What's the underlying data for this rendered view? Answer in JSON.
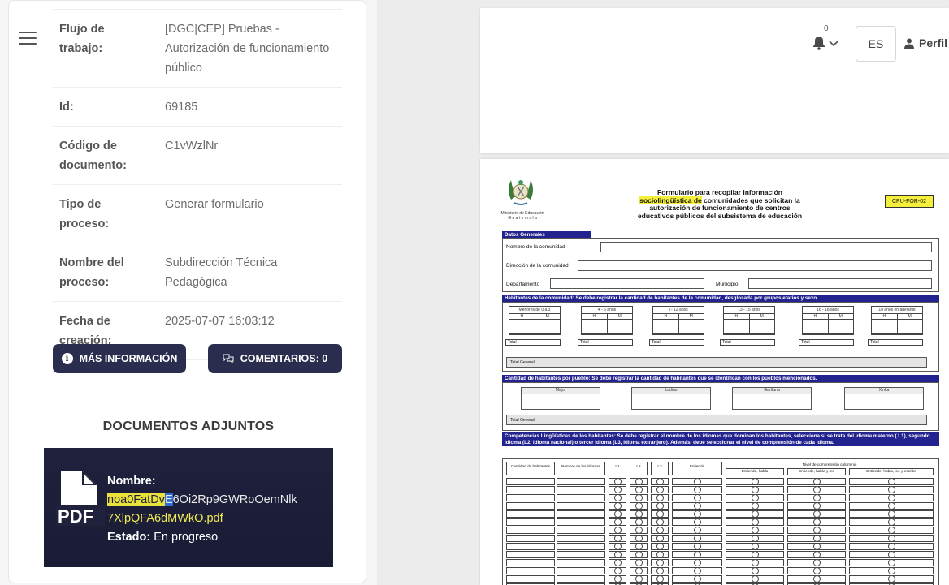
{
  "sidebar": {
    "menu_icon": "hamburger-menu-icon"
  },
  "info": [
    {
      "label": "Flujo de trabajo:",
      "value": "[DGC|CEP] Pruebas - Autorización de funcionamiento público"
    },
    {
      "label": "Id:",
      "value": "69185"
    },
    {
      "label": "Código de documento:",
      "value": "C1vWzlNr"
    },
    {
      "label": "Tipo de proceso:",
      "value": "Generar formulario"
    },
    {
      "label": "Nombre del proceso:",
      "value": "Subdirección Técnica Pedagógica"
    },
    {
      "label": "Fecha de creación:",
      "value": "2025-07-07 16:03:12"
    }
  ],
  "buttons": {
    "more_info": "MÁS INFORMACIÓN",
    "comments": "COMENTARIOS: 0"
  },
  "attachments": {
    "title": "DOCUMENTOS ADJUNTOS",
    "name_label": "Nombre:",
    "file_part1": "noa0FatDv",
    "file_part2": "E",
    "file_part3": "6Oi2Rp9GWRoOemNlk",
    "file_part4": "7XlpQFA6dMWkO.pdf",
    "status_label": "Estado:",
    "status_value": "En progreso",
    "file_icon_text": "PDF"
  },
  "topbar": {
    "notif_count": "0",
    "lang": "ES",
    "profile": "Perfil"
  },
  "form": {
    "ministry": "Ministerio de Educación",
    "country": "G u a t e m a l a",
    "title_l1": "Formulario para recopilar información",
    "title_l2a": "sociolingüística de",
    "title_l2b": " comunidades que solicitan la",
    "title_l3": "autorización de funcionamiento de centros",
    "title_l4": "educativos públicos del subsistema de educación",
    "code": "CPU-FOR-02",
    "sec_general": "Datos Generales",
    "lbl_nombre": "Nombre de la comunidad",
    "lbl_direccion": "Dirección de la comunidad",
    "lbl_depto": "Departamento",
    "lbl_municipio": "Municipio",
    "sec_habitantes": "Habitantes de la comunidad: Se debe registrar la cantidad de habitantes de la comunidad, desglosada por grupos etarios y sexo.",
    "age_groups": [
      "Menores de 0 a 3",
      "4 - 6 años",
      "7- 12 años",
      "13 - 15 años",
      "16 - 18 años",
      "18 años en adelante"
    ],
    "h": "H",
    "m": "M",
    "total": "Total",
    "total_general": "Total General",
    "sec_pueblo": "Cantidad de habitantes por pueblo: Se debe registrar la cantidad de habitantes que se identifican con los pueblos mencionados.",
    "pueblos": [
      "Maya",
      "Ladino",
      "Garífuna",
      "Xinka"
    ],
    "sec_comp": "Competencias Lingüísticas de los habitantes: Se debe registrar el nombre de los idiomas que dominan los habitantes, selecciona si se trata del idioma materno ( L1), segundo idioma (L2, idioma nacional) o tercer idioma (L3, idioma extranjero). Además, debe seleccionar el nivel de comprensión de cada idioma.",
    "th_cant": "Cantidad de habitantes",
    "th_nombre": "Nombre de los idiomas",
    "th_l1": "L1",
    "th_l2": "L2",
    "th_l3": "L3",
    "th_entiende": "Entiende",
    "th_nivel": "Nivel de comprensión o dominio",
    "th_eh": "Entiende, habla",
    "th_ehl": "Entiende, habla y lee",
    "th_ehle": "Entiende, habla, lee y escribe"
  }
}
